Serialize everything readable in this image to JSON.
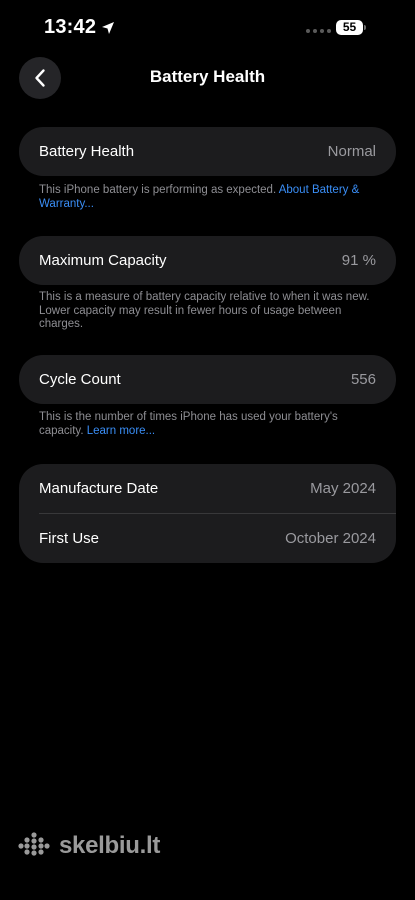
{
  "status_bar": {
    "time": "13:42",
    "battery_level": "55"
  },
  "nav": {
    "title": "Battery Health"
  },
  "battery_health": {
    "label": "Battery Health",
    "value": "Normal",
    "note": "This iPhone battery is performing as expected. ",
    "note_link": "About Battery & Warranty..."
  },
  "max_capacity": {
    "label": "Maximum Capacity",
    "value": "91 %",
    "note": "This is a measure of battery capacity relative to when it was new. Lower capacity may result in fewer hours of usage between charges."
  },
  "cycle_count": {
    "label": "Cycle Count",
    "value": "556",
    "note": "This is the number of times iPhone has used your battery's capacity. ",
    "note_link": "Learn more..."
  },
  "dates": {
    "manufacture_label": "Manufacture Date",
    "manufacture_value": "May 2024",
    "first_use_label": "First Use",
    "first_use_value": "October 2024"
  },
  "watermark": {
    "text": "skelbiu.lt"
  },
  "colors": {
    "background": "#000000",
    "card": "#1c1c1e",
    "link": "#3a8ef6",
    "secondary_text": "#9a9a9f"
  }
}
